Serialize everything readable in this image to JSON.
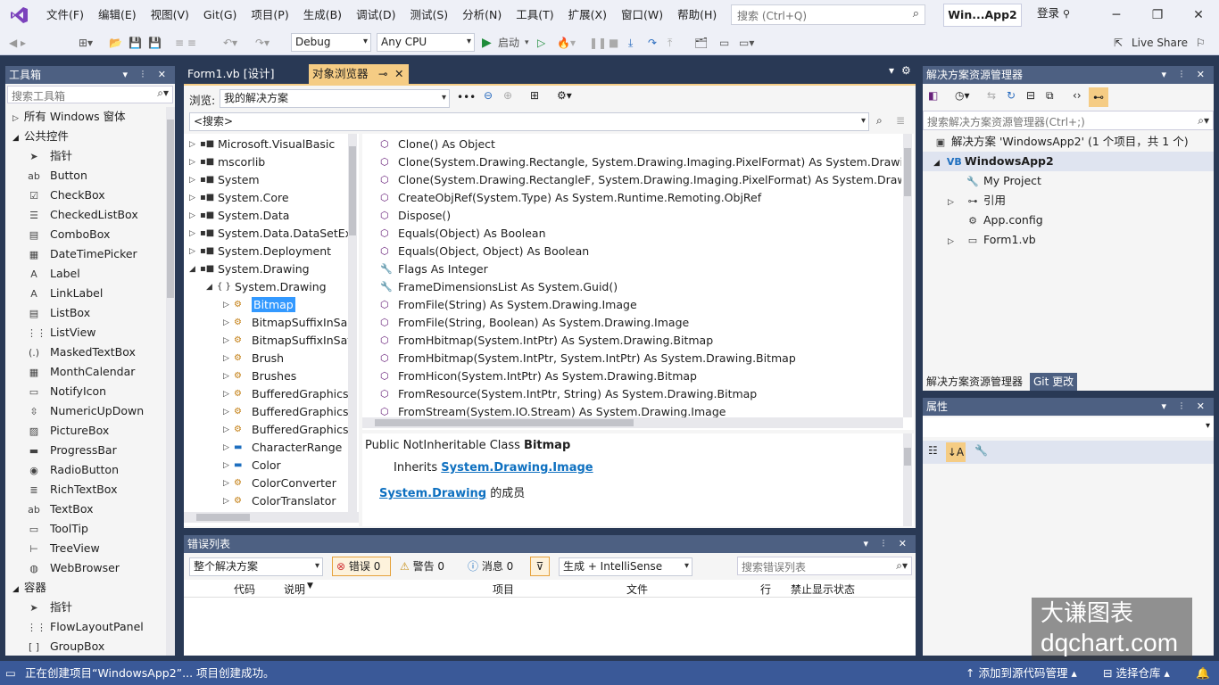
{
  "menubar": {
    "items": [
      "文件(F)",
      "编辑(E)",
      "视图(V)",
      "Git(G)",
      "项目(P)",
      "生成(B)",
      "调试(D)",
      "测试(S)",
      "分析(N)",
      "工具(T)",
      "扩展(X)",
      "窗口(W)",
      "帮助(H)"
    ],
    "search_placeholder": "搜索 (Ctrl+Q)",
    "solution_badge": "Win...App2",
    "login": "登录",
    "live_share": "Live Share"
  },
  "toolbar": {
    "config": "Debug",
    "platform": "Any CPU",
    "start_label": "启动"
  },
  "toolbox": {
    "title": "工具箱",
    "search_placeholder": "搜索工具箱",
    "groups": [
      {
        "label": "所有 Windows 窗体",
        "expanded": false
      },
      {
        "label": "公共控件",
        "expanded": true
      }
    ],
    "items": [
      {
        "label": "指针",
        "icon": "pointer-icon",
        "glyph": "➤"
      },
      {
        "label": "Button",
        "icon": "button-icon",
        "glyph": "ab"
      },
      {
        "label": "CheckBox",
        "icon": "checkbox-icon",
        "glyph": "☑"
      },
      {
        "label": "CheckedListBox",
        "icon": "checkedlistbox-icon",
        "glyph": "☰"
      },
      {
        "label": "ComboBox",
        "icon": "combobox-icon",
        "glyph": "▤"
      },
      {
        "label": "DateTimePicker",
        "icon": "datetimepicker-icon",
        "glyph": "▦"
      },
      {
        "label": "Label",
        "icon": "label-icon",
        "glyph": "A"
      },
      {
        "label": "LinkLabel",
        "icon": "linklabel-icon",
        "glyph": "A"
      },
      {
        "label": "ListBox",
        "icon": "listbox-icon",
        "glyph": "▤"
      },
      {
        "label": "ListView",
        "icon": "listview-icon",
        "glyph": "⋮⋮"
      },
      {
        "label": "MaskedTextBox",
        "icon": "maskedtextbox-icon",
        "glyph": "(.)"
      },
      {
        "label": "MonthCalendar",
        "icon": "monthcalendar-icon",
        "glyph": "▦"
      },
      {
        "label": "NotifyIcon",
        "icon": "notifyicon-icon",
        "glyph": "▭"
      },
      {
        "label": "NumericUpDown",
        "icon": "numericupdown-icon",
        "glyph": "⇳"
      },
      {
        "label": "PictureBox",
        "icon": "picturebox-icon",
        "glyph": "▨"
      },
      {
        "label": "ProgressBar",
        "icon": "progressbar-icon",
        "glyph": "▬"
      },
      {
        "label": "RadioButton",
        "icon": "radiobutton-icon",
        "glyph": "◉"
      },
      {
        "label": "RichTextBox",
        "icon": "richtextbox-icon",
        "glyph": "≣"
      },
      {
        "label": "TextBox",
        "icon": "textbox-icon",
        "glyph": "ab"
      },
      {
        "label": "ToolTip",
        "icon": "tooltip-icon",
        "glyph": "▭"
      },
      {
        "label": "TreeView",
        "icon": "treeview-icon",
        "glyph": "⊢"
      },
      {
        "label": "WebBrowser",
        "icon": "webbrowser-icon",
        "glyph": "◍"
      }
    ],
    "group2": "容器",
    "items2": [
      {
        "label": "指针",
        "icon": "pointer-icon",
        "glyph": "➤"
      },
      {
        "label": "FlowLayoutPanel",
        "icon": "flowlayoutpanel-icon",
        "glyph": "⋮⋮"
      },
      {
        "label": "GroupBox",
        "icon": "groupbox-icon",
        "glyph": "[ ]"
      }
    ]
  },
  "doc_tabs": [
    {
      "label": "Form1.vb [设计]",
      "active": false
    },
    {
      "label": "对象浏览器",
      "active": true
    }
  ],
  "object_browser": {
    "browse_label": "浏览:",
    "browse_value": "我的解决方案",
    "search_value": "<搜索>",
    "tree": [
      {
        "label": "Microsoft.VisualBasic",
        "level": 0,
        "icon": "assembly-icon"
      },
      {
        "label": "mscorlib",
        "level": 0,
        "icon": "assembly-icon"
      },
      {
        "label": "System",
        "level": 0,
        "icon": "assembly-icon"
      },
      {
        "label": "System.Core",
        "level": 0,
        "icon": "assembly-icon"
      },
      {
        "label": "System.Data",
        "level": 0,
        "icon": "assembly-icon"
      },
      {
        "label": "System.Data.DataSetExte",
        "level": 0,
        "icon": "assembly-icon"
      },
      {
        "label": "System.Deployment",
        "level": 0,
        "icon": "assembly-icon"
      },
      {
        "label": "System.Drawing",
        "level": 0,
        "icon": "assembly-icon",
        "expanded": true
      },
      {
        "label": "System.Drawing",
        "level": 1,
        "icon": "namespace-icon",
        "expanded": true
      },
      {
        "label": "Bitmap",
        "level": 2,
        "icon": "class-icon",
        "selected": true
      },
      {
        "label": "BitmapSuffixInSar",
        "level": 2,
        "icon": "class-icon"
      },
      {
        "label": "BitmapSuffixInSat",
        "level": 2,
        "icon": "class-icon"
      },
      {
        "label": "Brush",
        "level": 2,
        "icon": "class-icon"
      },
      {
        "label": "Brushes",
        "level": 2,
        "icon": "class-icon"
      },
      {
        "label": "BufferedGraphics",
        "level": 2,
        "icon": "class-icon"
      },
      {
        "label": "BufferedGraphics",
        "level": 2,
        "icon": "class-icon"
      },
      {
        "label": "BufferedGraphics",
        "level": 2,
        "icon": "class-icon"
      },
      {
        "label": "CharacterRange",
        "level": 2,
        "icon": "struct-icon"
      },
      {
        "label": "Color",
        "level": 2,
        "icon": "struct-icon"
      },
      {
        "label": "ColorConverter",
        "level": 2,
        "icon": "class-icon"
      },
      {
        "label": "ColorTranslator",
        "level": 2,
        "icon": "class-icon"
      }
    ],
    "members": [
      {
        "label": "Clone() As Object",
        "icon": "method-icon"
      },
      {
        "label": "Clone(System.Drawing.Rectangle, System.Drawing.Imaging.PixelFormat) As System.Drawing.Bitma",
        "icon": "method-icon"
      },
      {
        "label": "Clone(System.Drawing.RectangleF, System.Drawing.Imaging.PixelFormat) As System.Drawing.Bitm",
        "icon": "method-icon"
      },
      {
        "label": "CreateObjRef(System.Type) As System.Runtime.Remoting.ObjRef",
        "icon": "method-icon"
      },
      {
        "label": "Dispose()",
        "icon": "method-icon"
      },
      {
        "label": "Equals(Object) As Boolean",
        "icon": "method-icon"
      },
      {
        "label": "Equals(Object, Object) As Boolean",
        "icon": "method-icon"
      },
      {
        "label": "Flags As Integer",
        "icon": "property-icon"
      },
      {
        "label": "FrameDimensionsList As System.Guid()",
        "icon": "property-icon"
      },
      {
        "label": "FromFile(String) As System.Drawing.Image",
        "icon": "method-icon"
      },
      {
        "label": "FromFile(String, Boolean) As System.Drawing.Image",
        "icon": "method-icon"
      },
      {
        "label": "FromHbitmap(System.IntPtr) As System.Drawing.Bitmap",
        "icon": "method-icon"
      },
      {
        "label": "FromHbitmap(System.IntPtr, System.IntPtr) As System.Drawing.Bitmap",
        "icon": "method-icon"
      },
      {
        "label": "FromHicon(System.IntPtr) As System.Drawing.Bitmap",
        "icon": "method-icon"
      },
      {
        "label": "FromResource(System.IntPtr, String) As System.Drawing.Bitmap",
        "icon": "method-icon"
      },
      {
        "label": "FromStream(System.IO.Stream) As System.Drawing.Image",
        "icon": "method-icon"
      }
    ],
    "desc": {
      "decl_prefix": "Public NotInheritable Class ",
      "decl_name": "Bitmap",
      "inherits_label": "Inherits ",
      "inherits_link": "System.Drawing.Image",
      "ns_link": "System.Drawing",
      "ns_suffix": " 的成员"
    }
  },
  "error_list": {
    "title": "错误列表",
    "scope": "整个解决方案",
    "errors": "错误 0",
    "warnings": "警告 0",
    "messages": "消息 0",
    "build_filter": "生成 + IntelliSense",
    "search_placeholder": "搜索错误列表",
    "columns": [
      "代码",
      "说明",
      "项目",
      "文件",
      "行",
      "禁止显示状态"
    ]
  },
  "solution_explorer": {
    "title": "解决方案资源管理器",
    "search_placeholder": "搜索解决方案资源管理器(Ctrl+;)",
    "solution_label": "解决方案 'WindowsApp2' (1 个项目，共 1 个)",
    "project": "WindowsApp2",
    "items": [
      {
        "label": "My Project",
        "icon": "wrench-icon",
        "glyph": "🔧",
        "expandable": false
      },
      {
        "label": "引用",
        "icon": "references-icon",
        "glyph": "⊶",
        "expandable": true
      },
      {
        "label": "App.config",
        "icon": "config-icon",
        "glyph": "⚙",
        "expandable": false
      },
      {
        "label": "Form1.vb",
        "icon": "form-icon",
        "glyph": "▭",
        "expandable": true
      }
    ],
    "tab_active": "解决方案资源管理器",
    "tab_other": "Git 更改"
  },
  "properties": {
    "title": "属性"
  },
  "statusbar": {
    "message": "正在创建项目“WindowsApp2”... 项目创建成功。",
    "source_control": "添加到源代码管理",
    "repo": "选择仓库"
  },
  "watermark": {
    "line1": "大谦图表",
    "line2": "dqchart.com"
  },
  "colors": {
    "accent": "#293955",
    "tab_active": "#f5cc84",
    "panel_title": "#4d6082",
    "status": "#3a5998",
    "selection": "#3399ff"
  }
}
